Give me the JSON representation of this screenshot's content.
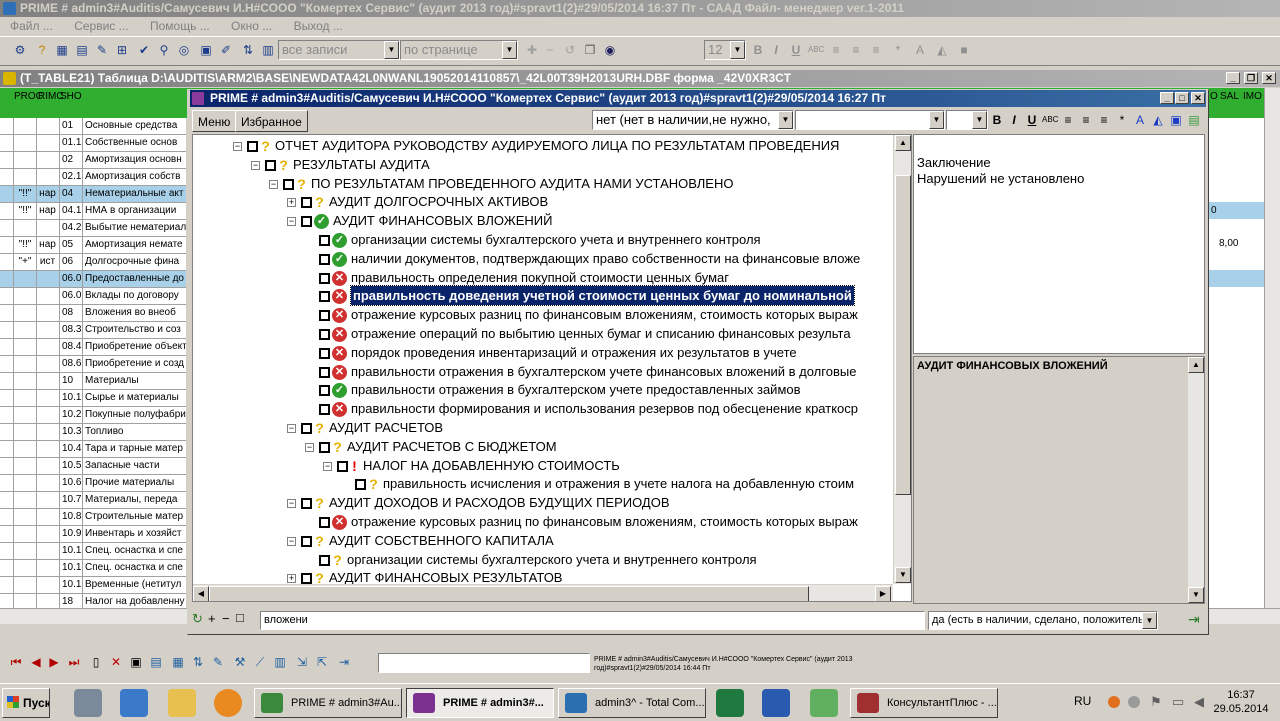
{
  "main_window": {
    "title": "PRIME # admin3#Auditis/Самусевич И.Н#СООО \"Комертех Сервис\" (аудит 2013 год)#spravt1(2)#29/05/2014 16:37 Пт - СААД Файл- менеджер ver.1-2011",
    "menu": [
      "Файл ...",
      "Сервис ...",
      "Помощь ...",
      "Окно ...",
      "Выход ..."
    ]
  },
  "toolbar": {
    "filter_records": "все записи",
    "filter_page": "по странице",
    "font_size": "12",
    "icons": [
      "bold-icon",
      "italic-icon",
      "underline-icon",
      "strikeout-icon",
      "align-left-icon",
      "align-center-icon",
      "align-right-icon",
      "asterisk-icon",
      "text-color-icon",
      "fill-color-icon",
      "square-icon"
    ]
  },
  "table_window": {
    "title": "(T_TABLE21) Таблица D:\\AUDITIS\\ARM2\\BASE\\NEWDATA42L0NWANL19052014110857\\_42L00T39H2013URH.DBF форма _42V0XR3CT",
    "columns": [
      "PROC",
      "RIMC",
      "SHO",
      ""
    ],
    "right_columns": [
      "O",
      "SAL",
      "IMO"
    ],
    "rows": [
      {
        "c0": "",
        "c1": "",
        "c2": "01",
        "c3": "Основные средства"
      },
      {
        "c0": "",
        "c1": "",
        "c2": "01.1",
        "c3": "Собственные основ"
      },
      {
        "c0": "",
        "c1": "",
        "c2": "02",
        "c3": "Амортизация основн"
      },
      {
        "c0": "",
        "c1": "",
        "c2": "02.1",
        "c3": "Амортизация собств"
      },
      {
        "c0": "\"!!\"",
        "c1": "нар",
        "c2": "04",
        "c3": "Нематериальные акт"
      },
      {
        "c0": "\"!!\"",
        "c1": "нар",
        "c2": "04.1",
        "c3": "НМА в организации"
      },
      {
        "c0": "",
        "c1": "",
        "c2": "04.2",
        "c3": "Выбытие нематериал"
      },
      {
        "c0": "\"!!\"",
        "c1": "нар",
        "c2": "05",
        "c3": "Амортизация немате"
      },
      {
        "c0": "\"+\"",
        "c1": "ист",
        "c2": "06",
        "c3": "Долгосрочные фина"
      },
      {
        "c0": "",
        "c1": "",
        "c2": "06.0",
        "c3": "Предоставленные до"
      },
      {
        "c0": "",
        "c1": "",
        "c2": "06.0",
        "c3": "Вклады по договору"
      },
      {
        "c0": "",
        "c1": "",
        "c2": "08",
        "c3": "Вложения во внеоб"
      },
      {
        "c0": "",
        "c1": "",
        "c2": "08.3",
        "c3": "Строительство и соз"
      },
      {
        "c0": "",
        "c1": "",
        "c2": "08.4",
        "c3": "Приобретение объект"
      },
      {
        "c0": "",
        "c1": "",
        "c2": "08.6",
        "c3": "Приобретение и созд"
      },
      {
        "c0": "",
        "c1": "",
        "c2": "10",
        "c3": "Материалы"
      },
      {
        "c0": "",
        "c1": "",
        "c2": "10.1",
        "c3": "Сырье и материалы"
      },
      {
        "c0": "",
        "c1": "",
        "c2": "10.2",
        "c3": "Покупные полуфабри"
      },
      {
        "c0": "",
        "c1": "",
        "c2": "10.3",
        "c3": "Топливо"
      },
      {
        "c0": "",
        "c1": "",
        "c2": "10.4",
        "c3": "Тара и тарные матер"
      },
      {
        "c0": "",
        "c1": "",
        "c2": "10.5",
        "c3": "Запасные части"
      },
      {
        "c0": "",
        "c1": "",
        "c2": "10.6",
        "c3": "Прочие материалы"
      },
      {
        "c0": "",
        "c1": "",
        "c2": "10.7",
        "c3": "Материалы, переда"
      },
      {
        "c0": "",
        "c1": "",
        "c2": "10.8",
        "c3": "Строительные матер"
      },
      {
        "c0": "",
        "c1": "",
        "c2": "10.9",
        "c3": "Инвентарь и хозяйст"
      },
      {
        "c0": "",
        "c1": "",
        "c2": "10.1",
        "c3": "Спец. оснастка и спе"
      },
      {
        "c0": "",
        "c1": "",
        "c2": "10.1",
        "c3": "Спец. оснастка и спе"
      },
      {
        "c0": "",
        "c1": "",
        "c2": "10.1",
        "c3": "Временные (нетитул"
      },
      {
        "c0": "",
        "c1": "",
        "c2": "18",
        "c3": "Налог на добавленну"
      }
    ],
    "right_values": [
      "0",
      "8,00"
    ]
  },
  "dialog": {
    "title": "PRIME # admin3#Auditis/Самусевич И.Н#СООО \"Комертех Сервис\" (аудит 2013 год)#spravt1(2)#29/05/2014 16:27 Пт",
    "tabs": [
      "Меню",
      "Избранное"
    ],
    "status_combo": "нет (нет в наличии,не нужно,",
    "tree": [
      {
        "level": 0,
        "exp": "−",
        "icon": "q",
        "text": "ОТЧЕТ АУДИТОРА РУКОВОДСТВУ АУДИРУЕМОГО ЛИЦА ПО РЕЗУЛЬТАТАМ ПРОВЕДЕНИЯ"
      },
      {
        "level": 1,
        "exp": "−",
        "icon": "q",
        "text": "РЕЗУЛЬТАТЫ АУДИТА"
      },
      {
        "level": 2,
        "exp": "−",
        "icon": "q",
        "text": "ПО РЕЗУЛЬТАТАМ ПРОВЕДЕННОГО АУДИТА НАМИ УСТАНОВЛЕНО"
      },
      {
        "level": 3,
        "exp": "+",
        "icon": "q",
        "text": "АУДИТ ДОЛГОСРОЧНЫХ АКТИВОВ"
      },
      {
        "level": 3,
        "exp": "−",
        "icon": "ok",
        "text": "АУДИТ ФИНАНСОВЫХ ВЛОЖЕНИЙ"
      },
      {
        "level": 4,
        "exp": "",
        "icon": "ok",
        "text": "организации системы бухгалтерского учета и внутреннего контроля"
      },
      {
        "level": 4,
        "exp": "",
        "icon": "ok",
        "text": "наличии документов, подтверждающих право собственности на финансовые вложе"
      },
      {
        "level": 4,
        "exp": "",
        "icon": "no",
        "text": "правильность определения покупной стоимости ценных бумаг"
      },
      {
        "level": 4,
        "exp": "",
        "icon": "no",
        "text": "правильность доведения учетной стоимости ценных бумаг до номинальной",
        "selected": true
      },
      {
        "level": 4,
        "exp": "",
        "icon": "no",
        "text": "отражение курсовых разниц по финансовым вложениям, стоимость которых выраж"
      },
      {
        "level": 4,
        "exp": "",
        "icon": "no",
        "text": "отражение операций по выбытию ценных бумаг и списанию финансовых результа"
      },
      {
        "level": 4,
        "exp": "",
        "icon": "no",
        "text": "порядок проведения инвентаризаций и отражения их результатов в учете"
      },
      {
        "level": 4,
        "exp": "",
        "icon": "no",
        "text": "правильности отражения в бухгалтерском учете финансовых вложений в долговые"
      },
      {
        "level": 4,
        "exp": "",
        "icon": "ok",
        "text": "правильности отражения в бухгалтерском учете предоставленных займов"
      },
      {
        "level": 4,
        "exp": "",
        "icon": "no",
        "text": "правильности формирования и использования резервов под обесценение краткоср"
      },
      {
        "level": 3,
        "exp": "−",
        "icon": "q",
        "text": "АУДИТ РАСЧЕТОВ"
      },
      {
        "level": 4,
        "exp": "−",
        "icon": "q",
        "text": "АУДИТ РАСЧЕТОВ С БЮДЖЕТОМ"
      },
      {
        "level": 5,
        "exp": "−",
        "icon": "ex",
        "text": "НАЛОГ НА ДОБАВЛЕННУЮ СТОИМОСТЬ"
      },
      {
        "level": 6,
        "exp": "",
        "icon": "q",
        "text": "правильность исчисления и отражения в учете налога на добавленную стоим"
      },
      {
        "level": 3,
        "exp": "−",
        "icon": "q",
        "text": "АУДИТ ДОХОДОВ И РАСХОДОВ БУДУЩИХ ПЕРИОДОВ"
      },
      {
        "level": 4,
        "exp": "",
        "icon": "no",
        "text": "отражение курсовых разниц по финансовым вложениям, стоимость которых выраж"
      },
      {
        "level": 3,
        "exp": "−",
        "icon": "q",
        "text": "АУДИТ СОБСТВЕННОГО КАПИТАЛА"
      },
      {
        "level": 4,
        "exp": "",
        "icon": "q",
        "text": "организации системы бухгалтерского учета и внутреннего контроля"
      },
      {
        "level": 3,
        "exp": "+",
        "icon": "q",
        "text": "АУДИТ ФИНАНСОВЫХ РЕЗУЛЬТАТОВ"
      }
    ],
    "conclusion_label": "Заключение",
    "conclusion_text": "Нарушений не установлено",
    "section_title": "АУДИТ ФИНАНСОВЫХ ВЛОЖЕНИЙ",
    "bottom_tools": [
      "↻",
      "+",
      "−",
      "□"
    ],
    "search_value": "вложени",
    "answer_combo": "да (есть в наличии, сделано, положительно"
  },
  "statusbar": {
    "small_text": "PRIME # admin3#Auditis/Самусевич И.Н#СООО \"Комертех Сервис\" (аудит 2013 год)#spravt1(2)#29/05/2014 16:44 Пт"
  },
  "taskbar": {
    "start": "Пуск",
    "tasks": [
      {
        "label": "PRIME # admin3#Au...",
        "active": false,
        "color": "#3b8a3b"
      },
      {
        "label": "PRIME # admin3#...",
        "active": true,
        "color": "#7b2f8f"
      },
      {
        "label": "admin3^ - Total Com...",
        "active": false,
        "color": "#2c6fb0"
      },
      {
        "label": "КонсультантПлюс - ...",
        "active": false,
        "color": "#a03030"
      }
    ],
    "lang": "RU",
    "time": "16:37",
    "date": "29.05.2014"
  }
}
